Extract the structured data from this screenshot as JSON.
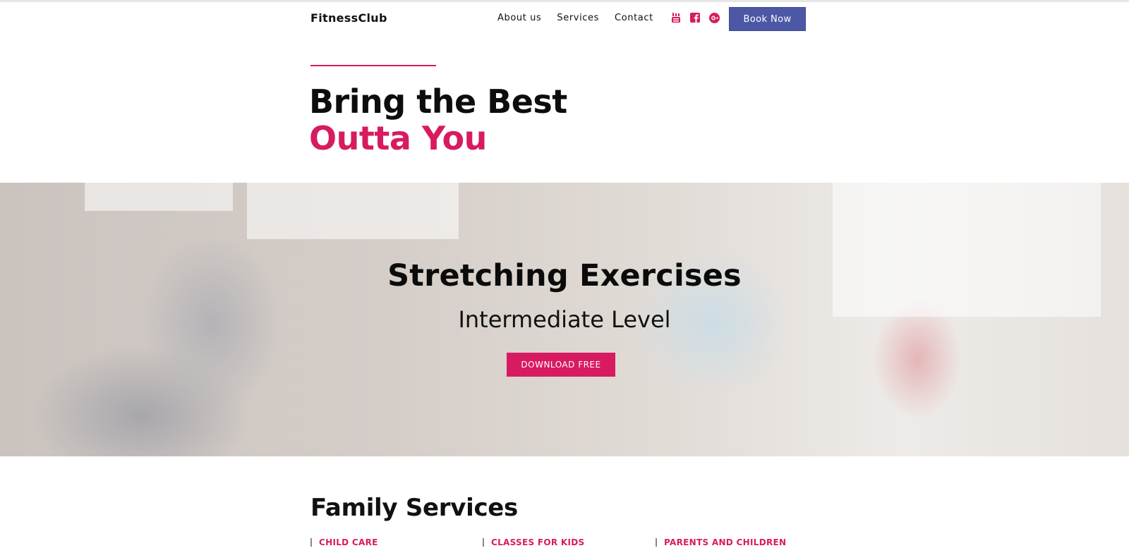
{
  "header": {
    "logo": "FitnessClub",
    "nav": [
      "About us",
      "Services",
      "Contact"
    ],
    "social_icons": [
      "youtube-icon",
      "facebook-icon",
      "google-plus-icon"
    ],
    "book_label": "Book Now"
  },
  "headline": {
    "line1": "Bring the Best",
    "line2": "Outta You"
  },
  "hero": {
    "title": "Stretching Exercises",
    "subtitle": "Intermediate Level",
    "download_label": "DOWNLOAD FREE"
  },
  "family": {
    "title": "Family Services",
    "tabs": [
      "CHILD CARE",
      "CLASSES FOR KIDS",
      "PARENTS AND CHILDREN"
    ]
  },
  "colors": {
    "accent": "#d81b60",
    "button_blue": "#4c58a6"
  }
}
